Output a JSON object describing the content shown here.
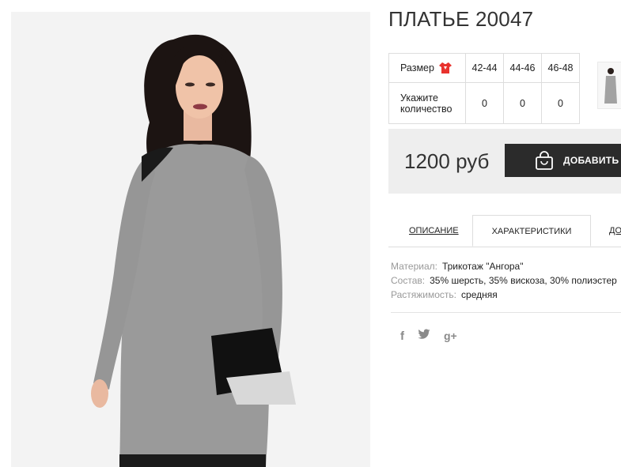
{
  "product": {
    "title": "ПЛАТЬЕ 20047"
  },
  "sizes": {
    "size_label": "Размер",
    "size_icon": "red-tshirt-icon",
    "qty_label_line1": "Укажите",
    "qty_label_line2": "количество",
    "columns": [
      "42-44",
      "44-46",
      "46-48"
    ],
    "quantities": [
      "0",
      "0",
      "0"
    ]
  },
  "purchase": {
    "price": "1200 руб",
    "add_to_cart_label": "ДОБАВИТЬ В",
    "bag_icon": "shopping-bag-icon"
  },
  "tabs": [
    {
      "label": "ОПИСАНИЕ",
      "active": false
    },
    {
      "label": "ХАРАКТЕРИСТИКИ",
      "active": true
    },
    {
      "label": "ДО",
      "active": false
    }
  ],
  "specs": [
    {
      "key": "Материал:",
      "value": "Трикотаж \"Ангора\""
    },
    {
      "key": "Состав:",
      "value": "35% шерсть, 35% вискоза, 30% полиэстер"
    },
    {
      "key": "Растяжимость:",
      "value": "средняя"
    }
  ],
  "social": {
    "facebook": "f",
    "twitter": "twitter-bird-icon",
    "googleplus": "g+"
  },
  "colors": {
    "button_bg": "#2b2b2b",
    "price_box_bg": "#eeeeee",
    "size_icon": "#e8322d"
  }
}
